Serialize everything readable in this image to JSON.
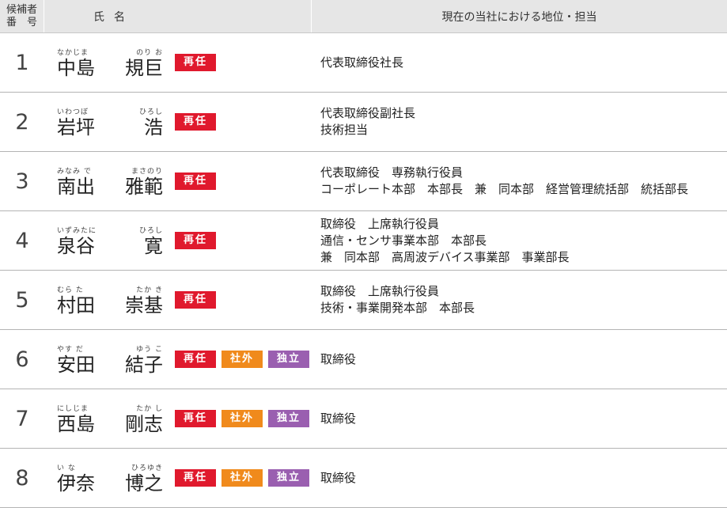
{
  "header": {
    "num_line1": "候補者",
    "num_line2": "番　号",
    "name": "氏名",
    "position": "現在の当社における地位・担当"
  },
  "badge_colors": {
    "reappoint": "#e0192d",
    "outside": "#f08a1c",
    "independent": "#9a5fb0"
  },
  "candidates": [
    {
      "num": "1",
      "surname": "中島",
      "surname_ruby": "なかじま",
      "given": "規巨",
      "given_ruby": "のり お",
      "badges": [
        "再任"
      ],
      "position": [
        "代表取締役社長"
      ]
    },
    {
      "num": "2",
      "surname": "岩坪",
      "surname_ruby": "いわつぼ",
      "given": "浩",
      "given_ruby": "ひろし",
      "badges": [
        "再任"
      ],
      "position": [
        "代表取締役副社長",
        "技術担当"
      ]
    },
    {
      "num": "3",
      "surname": "南出",
      "surname_ruby": "みなみ で",
      "given": "雅範",
      "given_ruby": "まさのり",
      "badges": [
        "再任"
      ],
      "position": [
        "代表取締役　専務執行役員",
        "コーポレート本部　本部長　兼　同本部　経営管理統括部　統括部長"
      ]
    },
    {
      "num": "4",
      "surname": "泉谷",
      "surname_ruby": "いずみたに",
      "given": "寛",
      "given_ruby": "ひろし",
      "badges": [
        "再任"
      ],
      "position": [
        "取締役　上席執行役員",
        "通信・センサ事業本部　本部長",
        "兼　同本部　高周波デバイス事業部　事業部長"
      ]
    },
    {
      "num": "5",
      "surname": "村田",
      "surname_ruby": "むら た",
      "given": "崇基",
      "given_ruby": "たか き",
      "badges": [
        "再任"
      ],
      "position": [
        "取締役　上席執行役員",
        "技術・事業開発本部　本部長"
      ]
    },
    {
      "num": "6",
      "surname": "安田",
      "surname_ruby": "やす だ",
      "given": "結子",
      "given_ruby": "ゆう こ",
      "badges": [
        "再任",
        "社外",
        "独立"
      ],
      "position": [
        "取締役"
      ]
    },
    {
      "num": "7",
      "surname": "西島",
      "surname_ruby": "にしじま",
      "given": "剛志",
      "given_ruby": "たか し",
      "badges": [
        "再任",
        "社外",
        "独立"
      ],
      "position": [
        "取締役"
      ]
    },
    {
      "num": "8",
      "surname": "伊奈",
      "surname_ruby": "い な",
      "given": "博之",
      "given_ruby": "ひろゆき",
      "badges": [
        "再任",
        "社外",
        "独立"
      ],
      "position": [
        "取締役"
      ]
    }
  ]
}
